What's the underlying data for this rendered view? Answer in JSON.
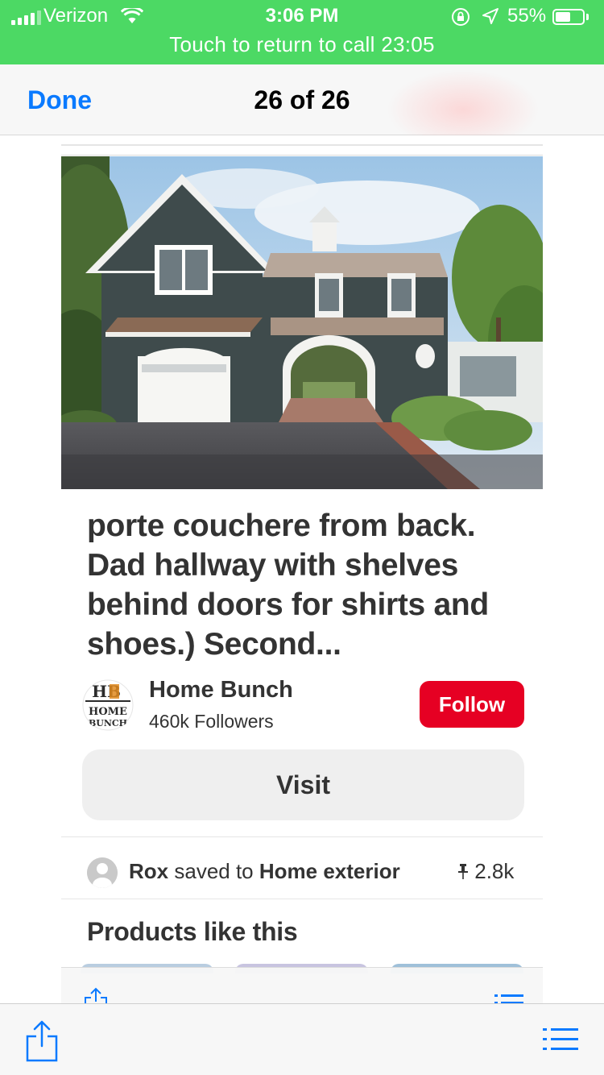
{
  "status_bar": {
    "carrier": "Verizon",
    "time": "3:06 PM",
    "battery_percent": "55%",
    "battery_level": 0.55,
    "call_banner": "Touch to return to call 23:05"
  },
  "nav": {
    "done_label": "Done",
    "page_counter": "26 of 26"
  },
  "pin": {
    "title": "porte couchere from back. Dad hallway with shelves behind doors for shirts and shoes.) Second...",
    "creator_name": "Home Bunch",
    "creator_followers": "460k Followers",
    "follow_label": "Follow",
    "visit_label": "Visit",
    "saver_name": "Rox",
    "saved_to_text": "saved to",
    "board_name": "Home exterior",
    "save_count": "2.8k",
    "products_heading": "Products like this"
  },
  "avatar_logo": {
    "line1": "HB",
    "line2": "HOME",
    "line3": "BUNCH"
  },
  "colors": {
    "status_green": "#4cd964",
    "ios_blue": "#0a7aff",
    "follow_red": "#e60023"
  },
  "icons": {
    "share": "share-icon",
    "list": "list-icon",
    "pin": "pushpin-icon",
    "wifi": "wifi-icon",
    "location": "location-arrow-icon",
    "orientation_lock": "orientation-lock-icon"
  }
}
